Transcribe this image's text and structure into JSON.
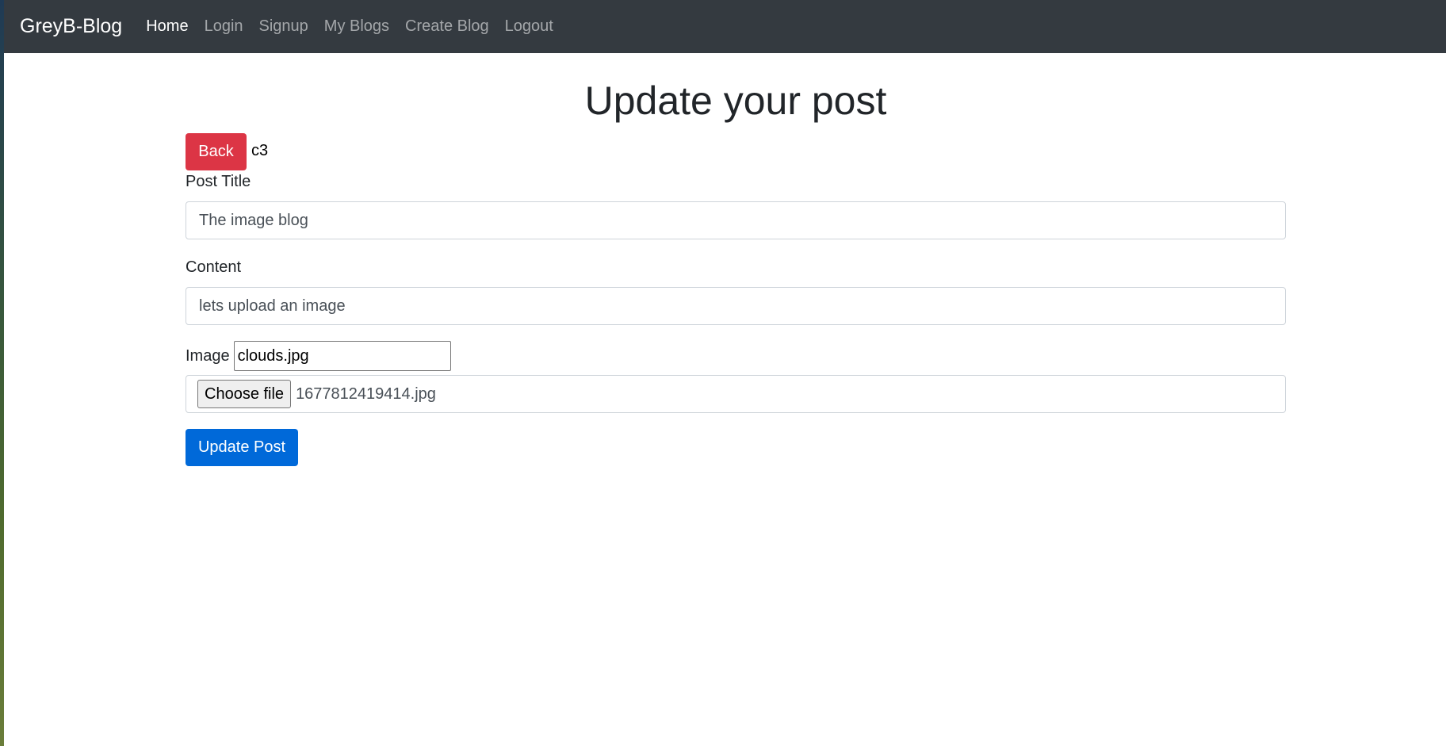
{
  "navbar": {
    "brand": "GreyB-Blog",
    "links": [
      {
        "label": "Home",
        "active": true
      },
      {
        "label": "Login",
        "active": false
      },
      {
        "label": "Signup",
        "active": false
      },
      {
        "label": "My Blogs",
        "active": false
      },
      {
        "label": "Create Blog",
        "active": false
      },
      {
        "label": "Logout",
        "active": false
      }
    ]
  },
  "page": {
    "title": "Update your post",
    "back_label": "Back",
    "back_note": "c3"
  },
  "form": {
    "post_title_label": "Post Title",
    "post_title_value": "The image blog",
    "content_label": "Content",
    "content_value": "lets upload an image",
    "image_label": "Image",
    "image_name_value": "clouds.jpg",
    "choose_file_label": "Choose file",
    "chosen_file_name": "1677812419414.jpg",
    "submit_label": "Update Post"
  },
  "colors": {
    "navbar_bg": "#343a40",
    "danger": "#dc3545",
    "primary": "#0069d9"
  }
}
